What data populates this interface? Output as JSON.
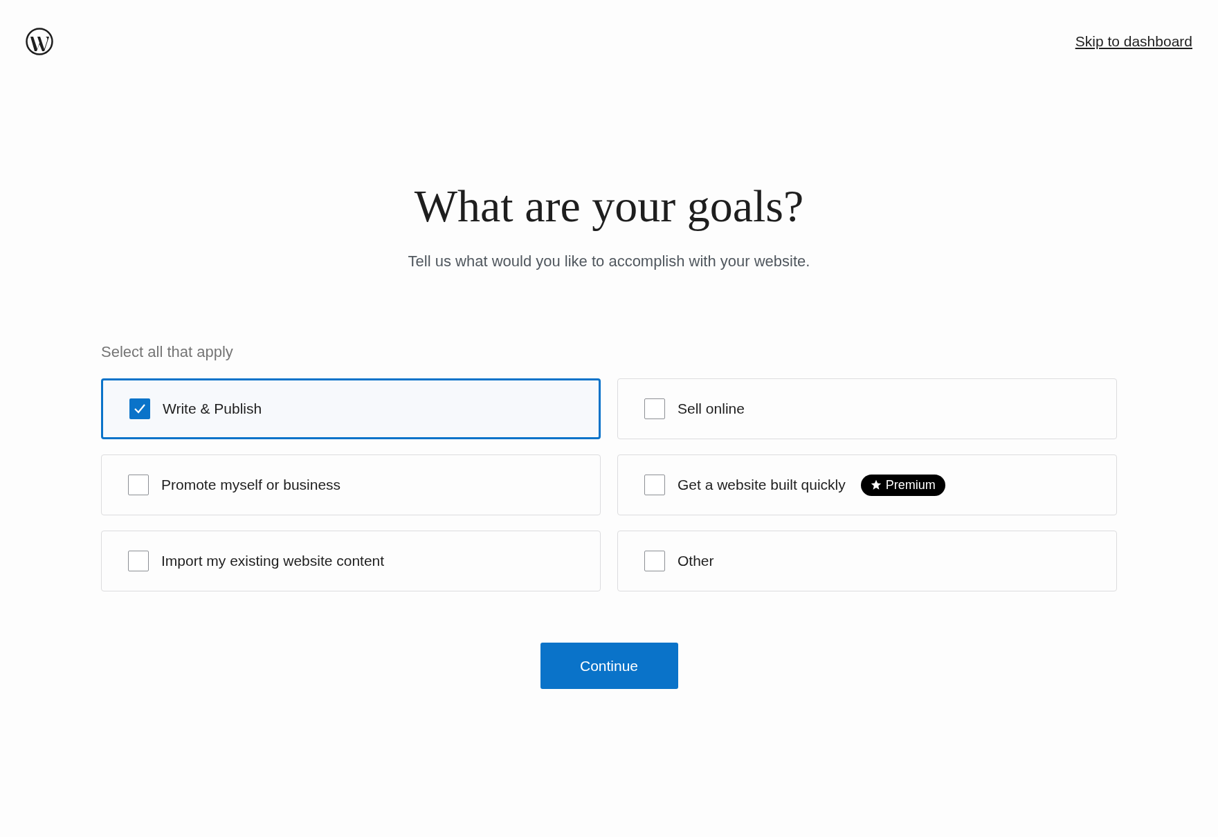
{
  "header": {
    "skip_link": "Skip to dashboard"
  },
  "title": "What are your goals?",
  "subtitle": "Tell us what would you like to accomplish with your website.",
  "hint": "Select all that apply",
  "goals": [
    {
      "label": "Write & Publish",
      "checked": true
    },
    {
      "label": "Sell online",
      "checked": false
    },
    {
      "label": "Promote myself or business",
      "checked": false
    },
    {
      "label": "Get a website built quickly",
      "checked": false,
      "badge": "Premium"
    },
    {
      "label": "Import my existing website content",
      "checked": false
    },
    {
      "label": "Other",
      "checked": false
    }
  ],
  "continue_button": "Continue"
}
